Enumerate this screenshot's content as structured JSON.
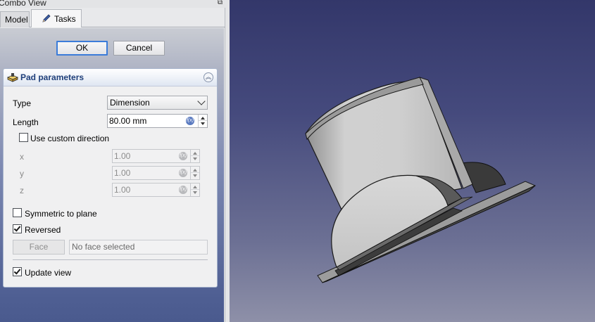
{
  "dock": {
    "title": "Combo View",
    "tabs": [
      {
        "label": "Model",
        "active": false
      },
      {
        "label": "Tasks",
        "active": true
      }
    ]
  },
  "dialog": {
    "ok_label": "OK",
    "cancel_label": "Cancel"
  },
  "pad": {
    "title": "Pad parameters",
    "type_label": "Type",
    "type_value": "Dimension",
    "length_label": "Length",
    "length_value": "80.00 mm",
    "custom_direction_label": "Use custom direction",
    "custom_direction_checked": false,
    "x_label": "x",
    "x_value": "1.00",
    "y_label": "y",
    "y_value": "1.00",
    "z_label": "z",
    "z_value": "1.00",
    "symmetric_label": "Symmetric to plane",
    "symmetric_checked": false,
    "reversed_label": "Reversed",
    "reversed_checked": true,
    "face_button_label": "Face",
    "face_field_value": "No face selected",
    "update_view_label": "Update view",
    "update_view_checked": true
  },
  "colors": {
    "accent": "#3b7cd9",
    "header_text": "#1f3f7a",
    "viewport_top": "#33376a",
    "viewport_bottom": "#8e90a8",
    "model_gray": "#c8c8c8"
  }
}
